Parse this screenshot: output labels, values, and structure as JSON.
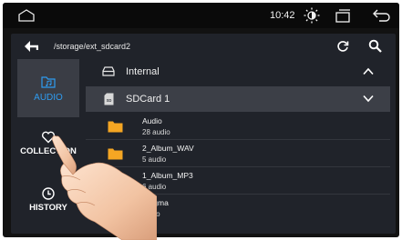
{
  "status_bar": {
    "time": "10:42",
    "icons": [
      "home-icon",
      "brightness-icon",
      "window-icon",
      "back-arrow-icon"
    ]
  },
  "path_bar": {
    "path": "/storage/ext_sdcard2",
    "icons": [
      "back-icon",
      "refresh-icon",
      "search-icon"
    ]
  },
  "sidebar": {
    "items": [
      {
        "label": "AUDIO",
        "icon": "music-folder-icon",
        "active": true
      },
      {
        "label": "COLLECTION",
        "icon": "heart-icon",
        "active": false
      },
      {
        "label": "HISTORY",
        "icon": "clock-icon",
        "active": false
      }
    ]
  },
  "storage": {
    "internal": {
      "label": "Internal",
      "state": "collapsed"
    },
    "sdcard": {
      "label": "SDCard 1",
      "state": "expanded"
    }
  },
  "folders": [
    {
      "name": "Audio",
      "count": "28 audio"
    },
    {
      "name": "2_Album_WAV",
      "count": "5 audio"
    },
    {
      "name": "1_Album_MP3",
      "count": "6 audio"
    },
    {
      "name": "Enigma",
      "count": "audio"
    }
  ],
  "colors": {
    "accent": "#2f9cf0",
    "folder": "#f5a623",
    "panel": "#20232a",
    "selected_row": "#3c3f47"
  }
}
